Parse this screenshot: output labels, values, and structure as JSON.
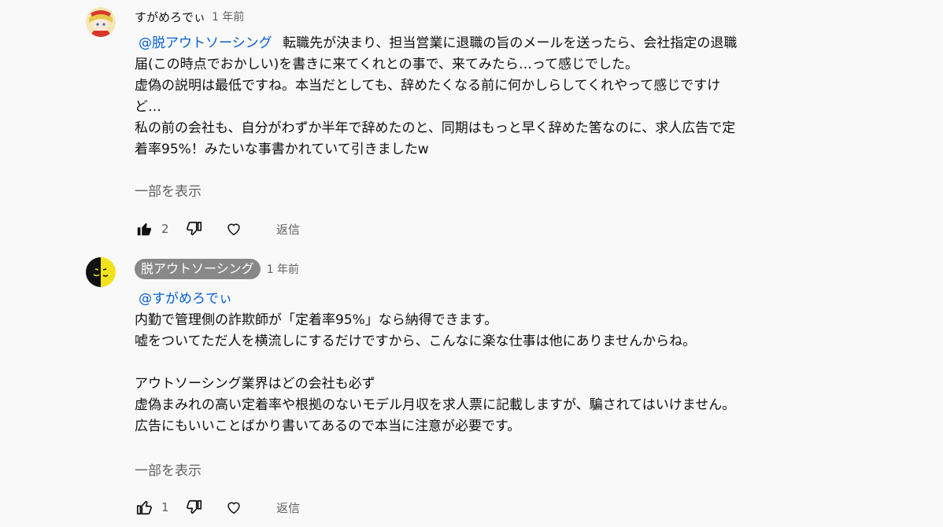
{
  "comments": [
    {
      "author": "すがめろでぃ",
      "time": "1 年前",
      "mention": "@脱アウトソーシング",
      "first_line_rest": "転職先が決まり、担当営業に退職の旨のメールを送ったら、会社指定の退職",
      "lines": [
        "届(この時点でおかしい)を書きに来てくれとの事で、来てみたら…って感じでした。",
        "虚偽の説明は最低ですね。本当だとしても、辞めたくなる前に何かしらしてくれやって感じですけ",
        "ど…",
        "私の前の会社も、自分がわずか半年で辞めたのと、同期はもっと早く辞めた筈なのに、求人広告で定",
        "着率95%！みたいな事書かれていて引きましたw"
      ],
      "show_more": "一部を表示",
      "like_count": "2",
      "reply_label": "返信",
      "liked": true
    },
    {
      "author": "脱アウトソーシング",
      "time": "1 年前",
      "mention": "@すがめろでぃ",
      "lines": [
        "内勤で管理側の詐欺師が「定着率95%」なら納得できます。",
        "嘘をついてただ人を横流しにするだけですから、こんなに楽な仕事は他にありませんからね。",
        "",
        "アウトソーシング業界はどの会社も必ず",
        "虚偽まみれの高い定着率や根拠のないモデル月収を求人票に記載しますが、騙されてはいけません。",
        "広告にもいいことばかり書いてあるので本当に注意が必要です。"
      ],
      "show_more": "一部を表示",
      "like_count": "1",
      "reply_label": "返信",
      "liked": false
    }
  ]
}
